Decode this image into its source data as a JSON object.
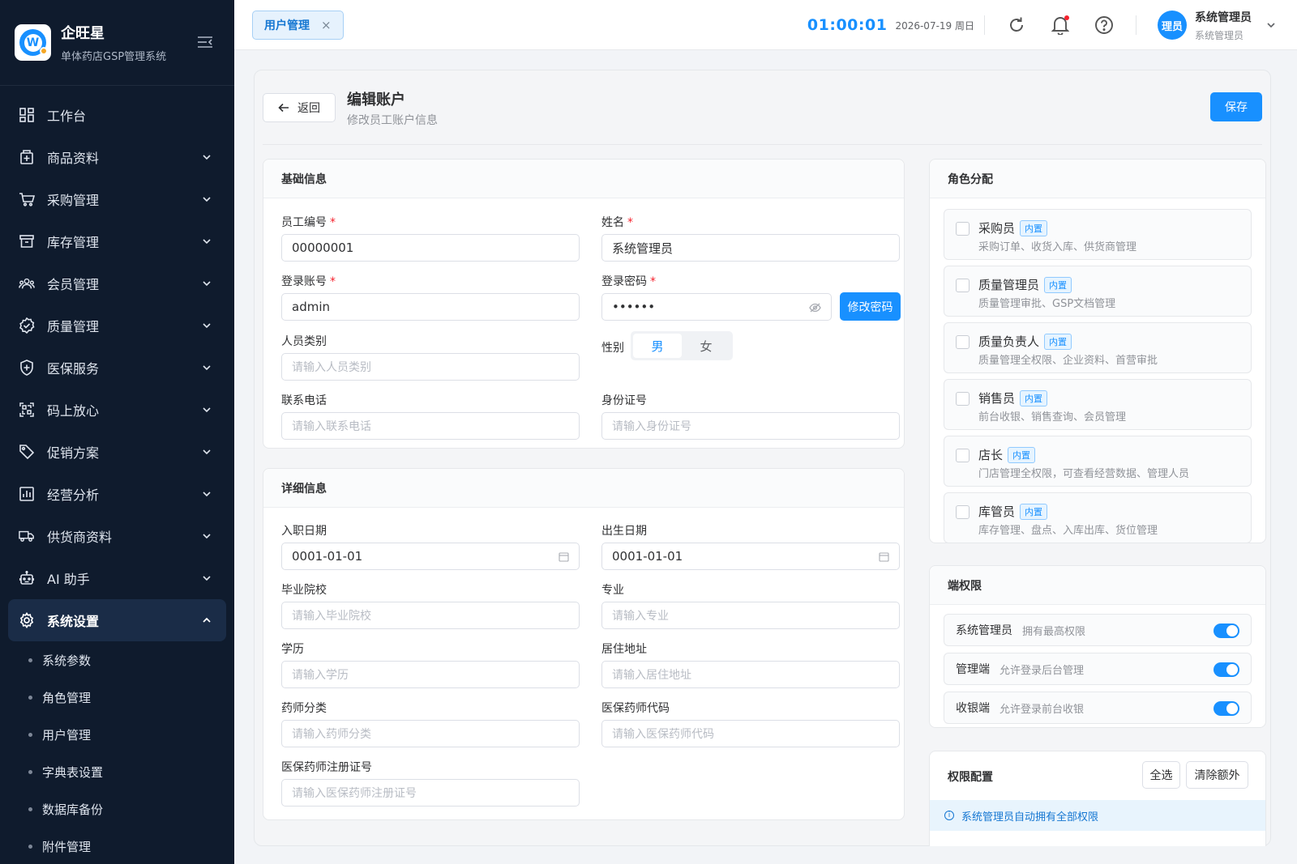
{
  "brand": {
    "name": "企旺星",
    "subtitle": "单体药店GSP管理系统"
  },
  "sidebar": {
    "items": [
      {
        "label": "工作台",
        "icon": "dashboard-icon"
      },
      {
        "label": "商品资料",
        "icon": "product-icon"
      },
      {
        "label": "采购管理",
        "icon": "cart-icon"
      },
      {
        "label": "库存管理",
        "icon": "inventory-icon"
      },
      {
        "label": "会员管理",
        "icon": "members-icon"
      },
      {
        "label": "质量管理",
        "icon": "quality-icon"
      },
      {
        "label": "医保服务",
        "icon": "shield-icon"
      },
      {
        "label": "码上放心",
        "icon": "qrcode-icon"
      },
      {
        "label": "促销方案",
        "icon": "tag-icon"
      },
      {
        "label": "经营分析",
        "icon": "chart-icon"
      },
      {
        "label": "供货商资料",
        "icon": "truck-icon"
      },
      {
        "label": "AI 助手",
        "icon": "robot-icon"
      },
      {
        "label": "系统设置",
        "icon": "gear-icon"
      }
    ],
    "sub_items": [
      "系统参数",
      "角色管理",
      "用户管理",
      "字典表设置",
      "数据库备份",
      "附件管理"
    ]
  },
  "header": {
    "tab_label": "用户管理",
    "tab_close": "×",
    "clock": "01:00:01",
    "date": "2026-07-19 周日",
    "avatar_text": "理员",
    "user_name": "系统管理员",
    "user_role": "系统管理员"
  },
  "page": {
    "back_label": "返回",
    "title": "编辑账户",
    "subtitle": "修改员工账户信息",
    "save_label": "保存"
  },
  "basic": {
    "title": "基础信息",
    "emp_no_label": "员工编号",
    "emp_no_value": "00000001",
    "name_label": "姓名",
    "name_value": "系统管理员",
    "login_label": "登录账号",
    "login_value": "admin",
    "pwd_label": "登录密码",
    "pwd_value": "••••••",
    "change_pwd_label": "修改密码",
    "type_label": "人员类别",
    "type_ph": "请输入人员类别",
    "gender_label": "性别",
    "gender_male": "男",
    "gender_female": "女",
    "gender_selected": "男",
    "phone_label": "联系电话",
    "phone_ph": "请输入联系电话",
    "id_label": "身份证号",
    "id_ph": "请输入身份证号",
    "required_mark": "*"
  },
  "detail": {
    "title": "详细信息",
    "hire_label": "入职日期",
    "hire_value": "0001-01-01",
    "birth_label": "出生日期",
    "birth_value": "0001-01-01",
    "school_label": "毕业院校",
    "school_ph": "请输入毕业院校",
    "major_label": "专业",
    "major_ph": "请输入专业",
    "edu_label": "学历",
    "edu_ph": "请输入学历",
    "addr_label": "居住地址",
    "addr_ph": "请输入居住地址",
    "pharm_label": "药师分类",
    "pharm_ph": "请输入药师分类",
    "code_label": "医保药师代码",
    "code_ph": "请输入医保药师代码",
    "reg_label": "医保药师注册证号",
    "reg_ph": "请输入医保药师注册证号"
  },
  "roles": {
    "title": "角色分配",
    "badge": "内置",
    "items": [
      {
        "name": "采购员",
        "desc": "采购订单、收货入库、供货商管理"
      },
      {
        "name": "质量管理员",
        "desc": "质量管理审批、GSP文档管理"
      },
      {
        "name": "质量负责人",
        "desc": "质量管理全权限、企业资料、首营审批"
      },
      {
        "name": "销售员",
        "desc": "前台收银、销售查询、会员管理"
      },
      {
        "name": "店长",
        "desc": "门店管理全权限，可查看经营数据、管理人员"
      },
      {
        "name": "库管员",
        "desc": "库存管理、盘点、入库出库、货位管理"
      }
    ]
  },
  "endpoints": {
    "title": "端权限",
    "items": [
      {
        "name": "系统管理员",
        "desc": "拥有最高权限",
        "on": true
      },
      {
        "name": "管理端",
        "desc": "允许登录后台管理",
        "on": true
      },
      {
        "name": "收银端",
        "desc": "允许登录前台收银",
        "on": true
      }
    ]
  },
  "permissions": {
    "title": "权限配置",
    "select_all": "全选",
    "clear_extra": "清除额外",
    "info": "系统管理员自动拥有全部权限"
  },
  "colors": {
    "primary": "#1890ff",
    "sidebar_bg": "#0f1b2d",
    "required": "#f5222d"
  }
}
